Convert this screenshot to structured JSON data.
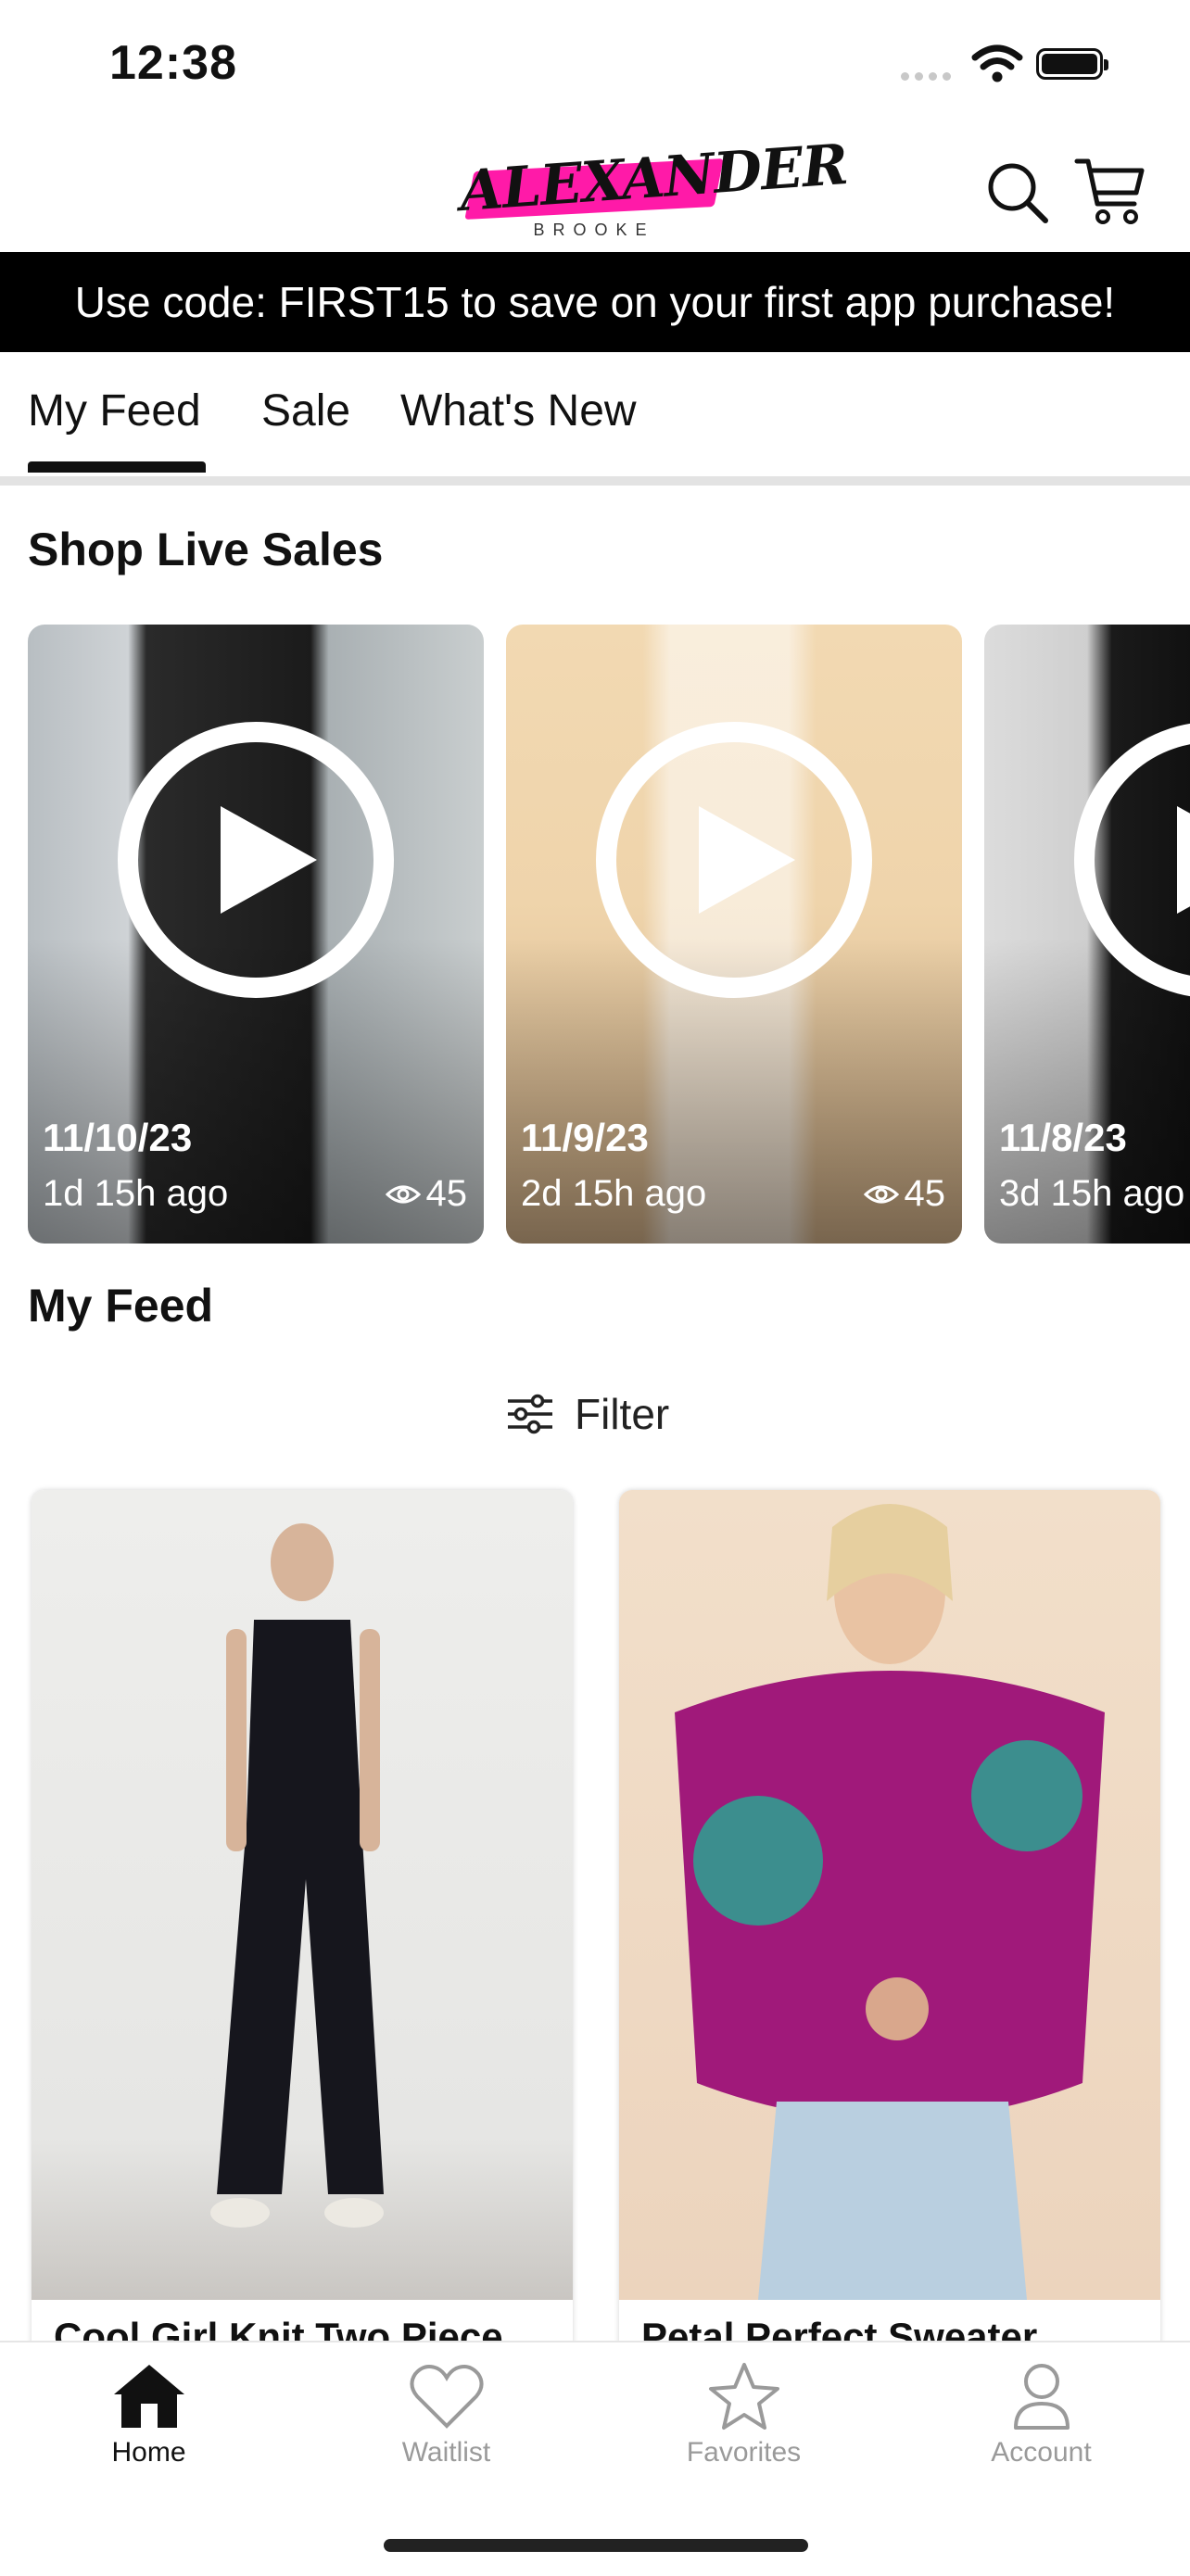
{
  "status_bar": {
    "time": "12:38"
  },
  "header": {
    "logo_main": "ALEXANDER",
    "logo_sub": "BROOKE",
    "icons": {
      "search": "search-icon",
      "cart": "cart-icon"
    },
    "accent_color": "#ff1aa8"
  },
  "promo": {
    "text": "Use code: FIRST15 to save on your first app purchase!"
  },
  "tabs": [
    {
      "label": "My Feed",
      "active": true
    },
    {
      "label": "Sale",
      "active": false
    },
    {
      "label": "What's New",
      "active": false
    }
  ],
  "live_sales": {
    "title": "Shop Live Sales",
    "items": [
      {
        "date": "11/10/23",
        "ago": "1d 15h ago",
        "views": "45"
      },
      {
        "date": "11/9/23",
        "ago": "2d 15h ago",
        "views": "45"
      },
      {
        "date": "11/8/23",
        "ago": "3d 15h ago",
        "views": ""
      }
    ]
  },
  "feed": {
    "title": "My Feed",
    "filter_label": "Filter",
    "products": [
      {
        "name": "Cool Girl Knit Two Piece"
      },
      {
        "name": "Petal Perfect Sweater"
      }
    ]
  },
  "tabbar": [
    {
      "label": "Home",
      "icon": "home-icon",
      "active": true
    },
    {
      "label": "Waitlist",
      "icon": "heart-icon",
      "active": false
    },
    {
      "label": "Favorites",
      "icon": "star-icon",
      "active": false
    },
    {
      "label": "Account",
      "icon": "person-icon",
      "active": false
    }
  ]
}
